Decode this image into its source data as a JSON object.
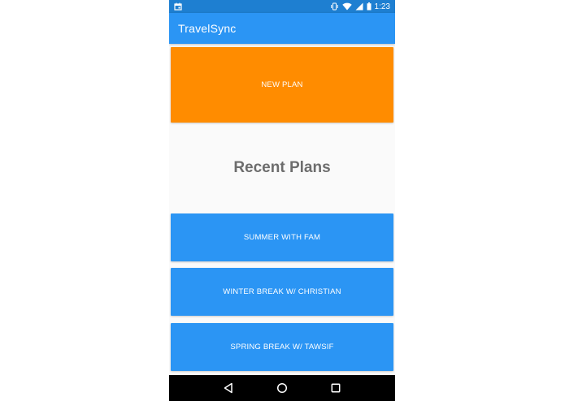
{
  "status_bar": {
    "time": "1:23",
    "icons": [
      "calendar-icon",
      "vibrate-icon",
      "wifi-icon",
      "signal-icon",
      "battery-icon"
    ]
  },
  "app_bar": {
    "title": "TravelSync"
  },
  "main": {
    "new_plan_label": "NEW PLAN",
    "recent_heading": "Recent Plans",
    "plans": [
      {
        "label": "SUMMER WITH FAM"
      },
      {
        "label": "WINTER BREAK W/ CHRISTIAN"
      },
      {
        "label": "SPRING BREAK W/ TAWSIF"
      }
    ]
  },
  "nav_bar": {
    "icons": [
      "back-icon",
      "home-icon",
      "recents-icon"
    ]
  },
  "colors": {
    "primary": "#2b95f4",
    "primary_dark": "#1e7fd1",
    "accent": "#ff8c00",
    "heading_text": "#6d6d6d",
    "background": "#fafafa"
  }
}
